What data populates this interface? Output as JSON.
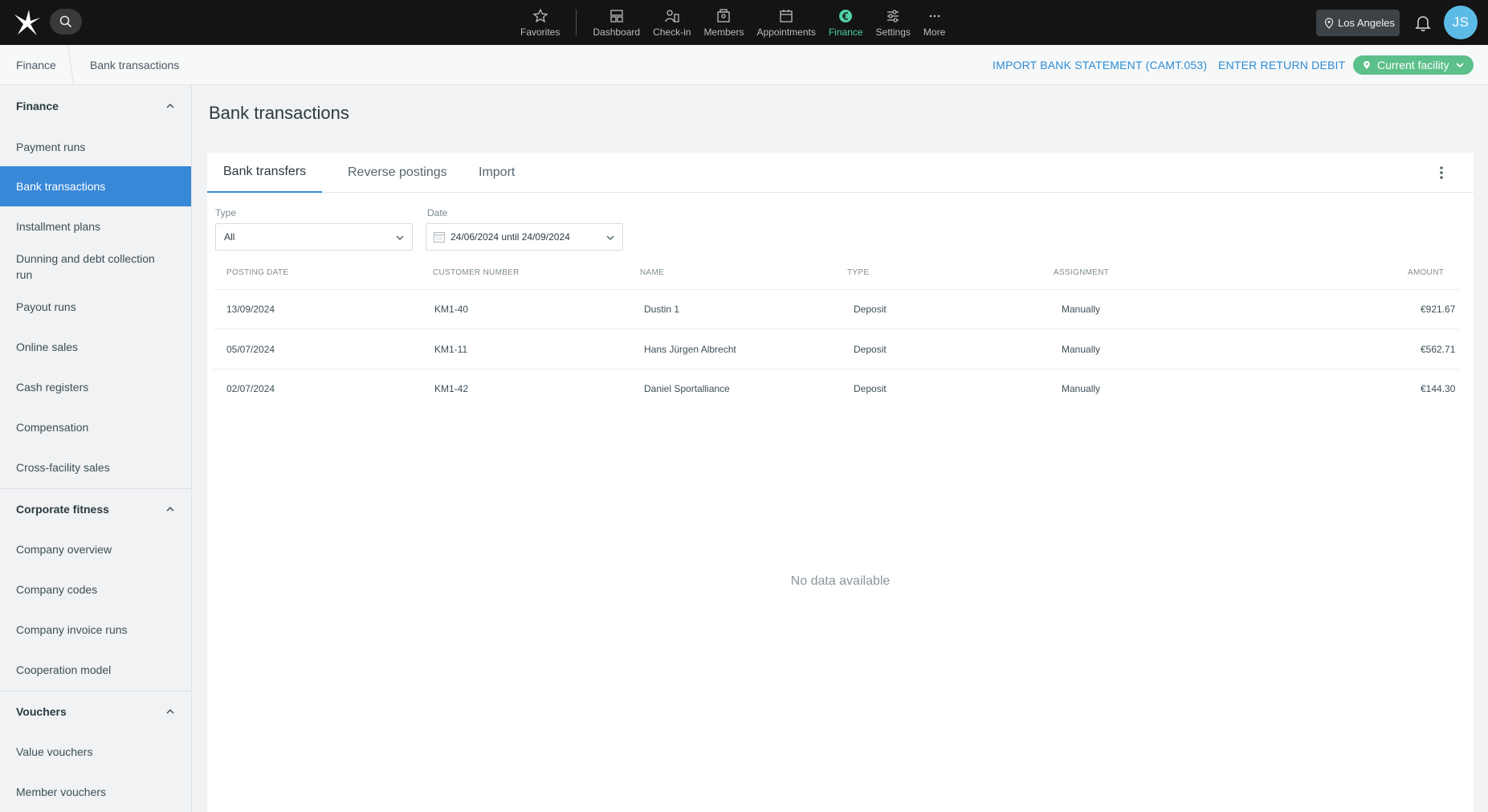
{
  "nav": {
    "items": [
      {
        "label": "Favorites",
        "icon": "star-icon"
      },
      {
        "label": "Dashboard",
        "icon": "dashboard-icon"
      },
      {
        "label": "Check-in",
        "icon": "checkin-icon"
      },
      {
        "label": "Members",
        "icon": "members-icon"
      },
      {
        "label": "Appointments",
        "icon": "calendar-icon"
      },
      {
        "label": "Finance",
        "icon": "euro-icon",
        "active": true
      },
      {
        "label": "Settings",
        "icon": "sliders-icon"
      },
      {
        "label": "More",
        "icon": "more-icon"
      }
    ],
    "location": "Los Angeles",
    "avatar_initials": "JS"
  },
  "breadcrumb": {
    "parent": "Finance",
    "current": "Bank transactions"
  },
  "actions": {
    "import_statement": "IMPORT BANK STATEMENT (CAMT.053)",
    "return_debit": "ENTER RETURN DEBIT",
    "facility": "Current facility"
  },
  "sidebar": {
    "sections": [
      {
        "title": "Finance",
        "items": [
          "Payment runs",
          "Bank transactions",
          "Installment plans",
          "Dunning and debt collection run",
          "Payout runs",
          "Online sales",
          "Cash registers",
          "Compensation",
          "Cross-facility sales"
        ]
      },
      {
        "title": "Corporate fitness",
        "items": [
          "Company overview",
          "Company codes",
          "Company invoice runs",
          "Cooperation model"
        ]
      },
      {
        "title": "Vouchers",
        "items": [
          "Value vouchers",
          "Member vouchers"
        ]
      }
    ],
    "active_item": "Bank transactions"
  },
  "page": {
    "title": "Bank transactions"
  },
  "tabs": [
    "Bank transfers",
    "Reverse postings",
    "Import"
  ],
  "filters": {
    "type_label": "Type",
    "type_value": "All",
    "date_label": "Date",
    "date_value": "24/06/2024 until 24/09/2024"
  },
  "table": {
    "headers": [
      "POSTING DATE",
      "CUSTOMER NUMBER",
      "NAME",
      "TYPE",
      "ASSIGNMENT",
      "AMOUNT"
    ],
    "rows": [
      [
        "13/09/2024",
        "KM1-40",
        "Dustin 1",
        "Deposit",
        "Manually",
        "€921.67"
      ],
      [
        "05/07/2024",
        "KM1-11",
        "Hans Jürgen Albrecht",
        "Deposit",
        "Manually",
        "€562.71"
      ],
      [
        "02/07/2024",
        "KM1-42",
        "Daniel Sportalliance",
        "Deposit",
        "Manually",
        "€144.30"
      ]
    ],
    "empty_text": "No data available"
  },
  "colors": {
    "accent": "#3888d8",
    "finance_active": "#4fd1a5",
    "facility_green": "#5cc08a",
    "avatar": "#5bbbe6"
  }
}
